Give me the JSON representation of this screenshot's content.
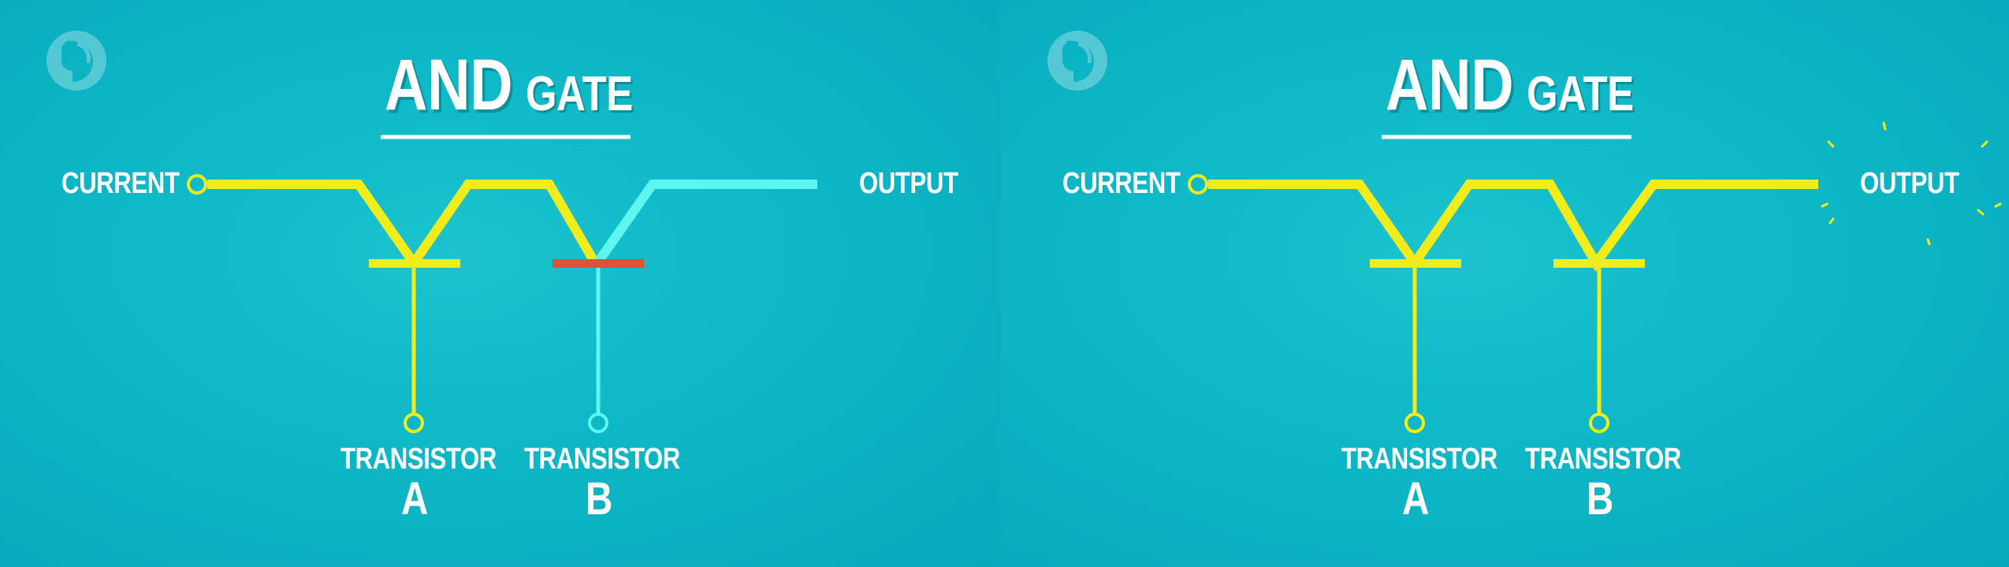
{
  "panels": [
    {
      "title_main": "AND",
      "title_sub": "GATE",
      "current_label": "CURRENT",
      "output_label": "OUTPUT",
      "transistors": [
        {
          "label": "TRANSISTOR",
          "letter": "A"
        },
        {
          "label": "TRANSISTOR",
          "letter": "B"
        }
      ],
      "state": {
        "transistor_a": "on",
        "transistor_b": "off",
        "output": "off"
      }
    },
    {
      "title_main": "AND",
      "title_sub": "GATE",
      "current_label": "CURRENT",
      "output_label": "OUTPUT",
      "transistors": [
        {
          "label": "TRANSISTOR",
          "letter": "A"
        },
        {
          "label": "TRANSISTOR",
          "letter": "B"
        }
      ],
      "state": {
        "transistor_a": "on",
        "transistor_b": "on",
        "output": "on"
      }
    }
  ],
  "logo_icon": "pbs-logo-icon",
  "colors": {
    "background": "#0fb3c2",
    "current_on": "#f2ed1a",
    "current_off": "#5ff5f0",
    "gate_off": "#e2503a",
    "text": "#ffffff"
  }
}
